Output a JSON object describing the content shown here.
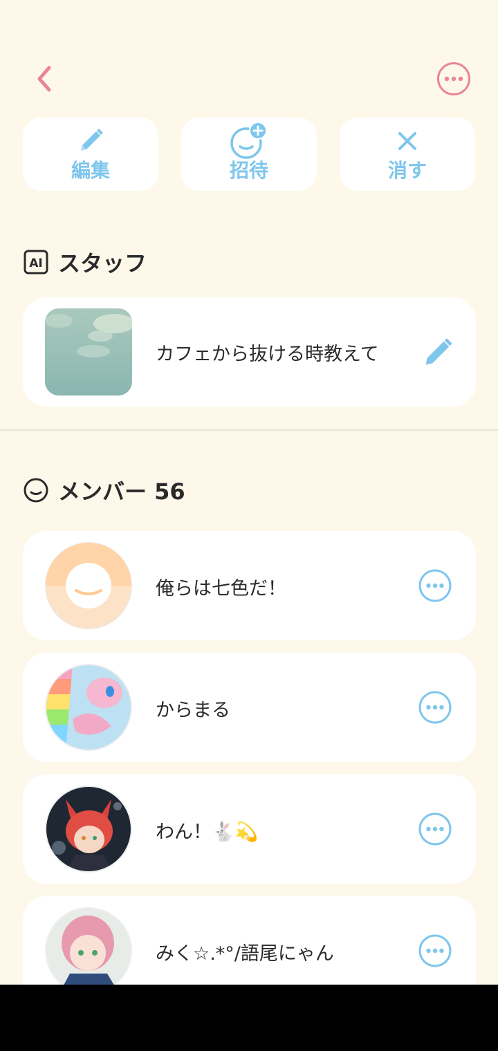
{
  "header": {
    "back_icon": "chevron-left-icon",
    "menu_icon": "more-horizontal-circle-icon"
  },
  "actions": [
    {
      "label": "編集",
      "icon": "pencil-icon"
    },
    {
      "label": "招待",
      "icon": "add-person-icon"
    },
    {
      "label": "消す",
      "icon": "close-icon"
    }
  ],
  "staff": {
    "title": "スタッフ",
    "badge": "AI",
    "item": {
      "name": "カフェから抜ける時教えて",
      "edit_icon": "pencil-icon"
    }
  },
  "members": {
    "title": "メンバー 56",
    "items": [
      {
        "name": "俺らは七色だ！"
      },
      {
        "name": "からまる"
      },
      {
        "name": "わん！🐇💫"
      },
      {
        "name": "みく☆.*°/語尾にゃん"
      }
    ]
  },
  "colors": {
    "background": "#fdf8ea",
    "accent_blue": "#7ec6ec",
    "accent_pink": "#e9849a"
  }
}
